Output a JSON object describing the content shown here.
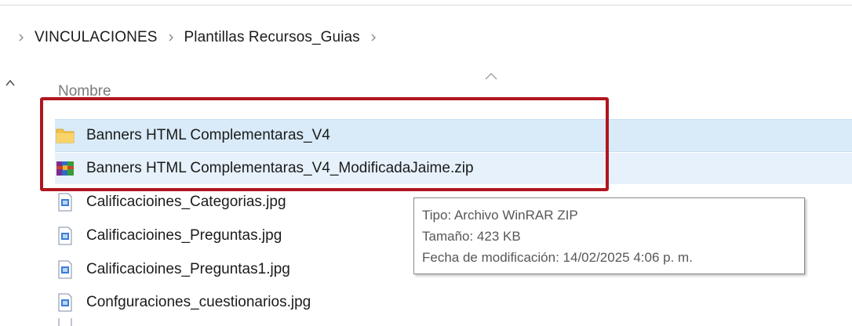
{
  "breadcrumb": {
    "items": [
      "VINCULACIONES",
      "Plantillas Recursos_Guias"
    ]
  },
  "file_list": {
    "column_header": "Nombre",
    "rows": [
      {
        "name": "Banners HTML Complementaras_V4",
        "icon": "folder-icon",
        "state": "selected"
      },
      {
        "name": "Banners HTML Complementaras_V4_ModificadaJaime.zip",
        "icon": "winrar-zip-icon",
        "state": "hovered"
      },
      {
        "name": "Calificacioines_Categorias.jpg",
        "icon": "jpg-file-icon",
        "state": "normal"
      },
      {
        "name": "Calificacioines_Preguntas.jpg",
        "icon": "jpg-file-icon",
        "state": "normal"
      },
      {
        "name": "Calificacioines_Preguntas1.jpg",
        "icon": "jpg-file-icon",
        "state": "normal"
      },
      {
        "name": "Confguraciones_cuestionarios.jpg",
        "icon": "jpg-file-icon",
        "state": "normal"
      }
    ]
  },
  "tooltip": {
    "type_line": "Tipo: Archivo WinRAR ZIP",
    "size_line": "Tamaño: 423 KB",
    "date_line": "Fecha de modificación: 14/02/2025 4:06 p. m."
  },
  "colors": {
    "selection": "#d9ebf9",
    "highlight_box": "#b0161e",
    "folder": "#f3c34b"
  }
}
